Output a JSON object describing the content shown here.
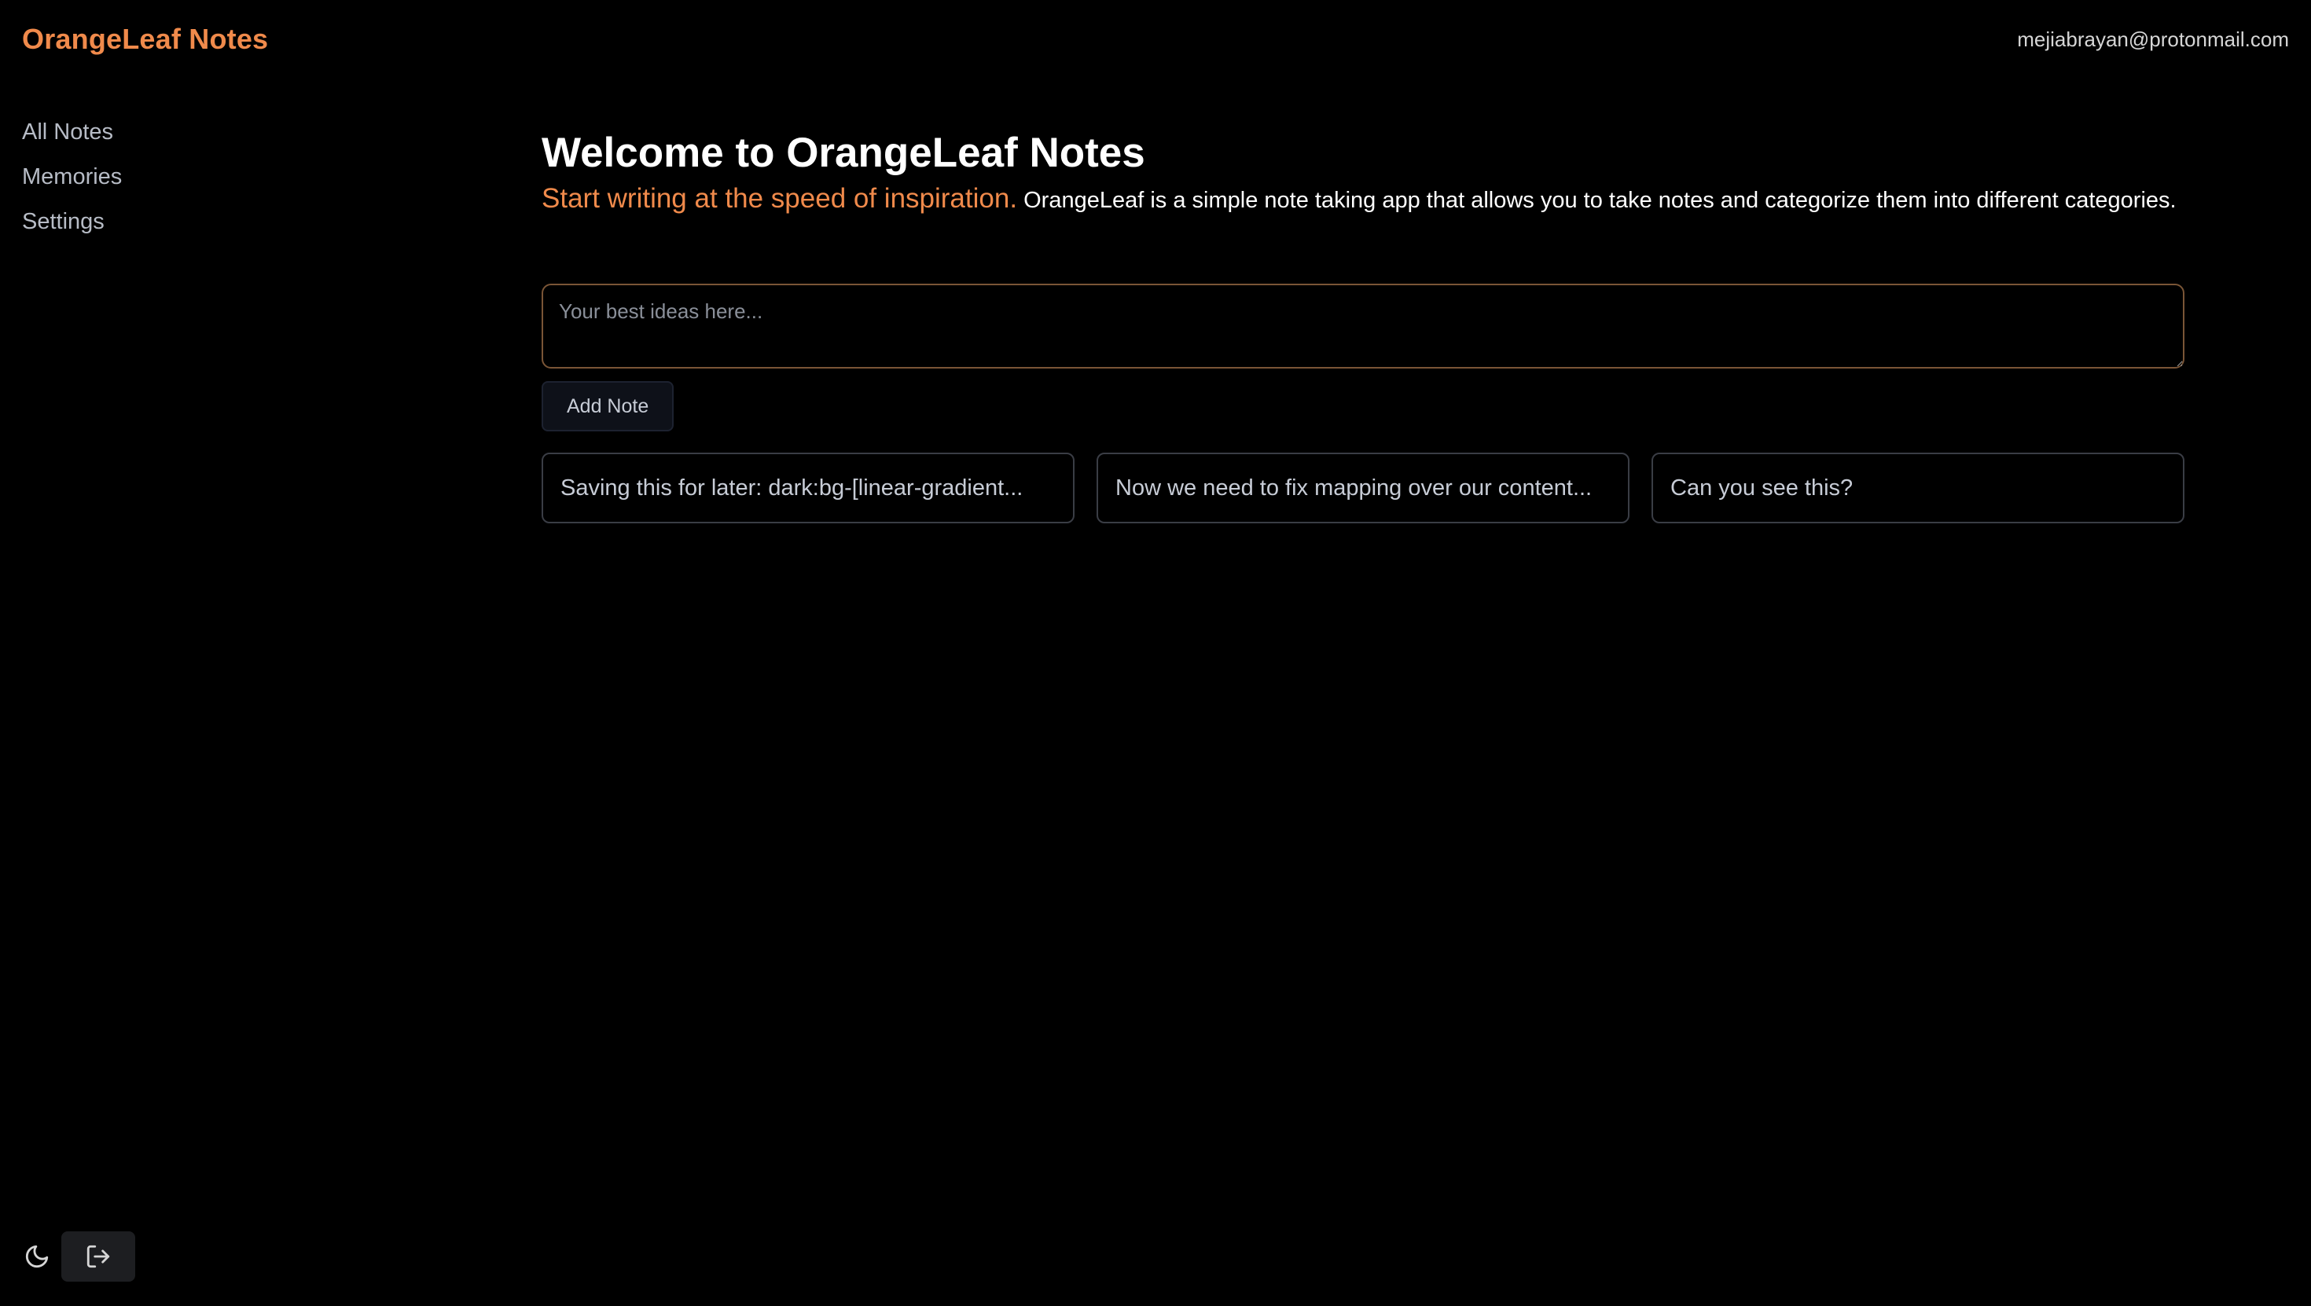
{
  "header": {
    "brand": "OrangeLeaf Notes",
    "user_email": "mejiabrayan@protonmail.com"
  },
  "sidebar": {
    "items": [
      {
        "label": "All Notes"
      },
      {
        "label": "Memories"
      },
      {
        "label": "Settings"
      }
    ]
  },
  "main": {
    "title": "Welcome to OrangeLeaf Notes",
    "tagline": "Start writing at the speed of inspiration.",
    "description": "OrangeLeaf is a simple note taking app that allows you to take notes and categorize them into different categories.",
    "input_placeholder": "Your best ideas here...",
    "add_button_label": "Add Note",
    "notes": [
      {
        "text": "Saving this for later: dark:bg-[linear-gradient..."
      },
      {
        "text": "Now we need to fix mapping over our content..."
      },
      {
        "text": "Can you see this?"
      }
    ]
  },
  "footer": {
    "theme_icon": "moon-icon",
    "logout_icon": "logout-icon"
  },
  "colors": {
    "accent": "#f08a4b",
    "background": "#000000"
  }
}
